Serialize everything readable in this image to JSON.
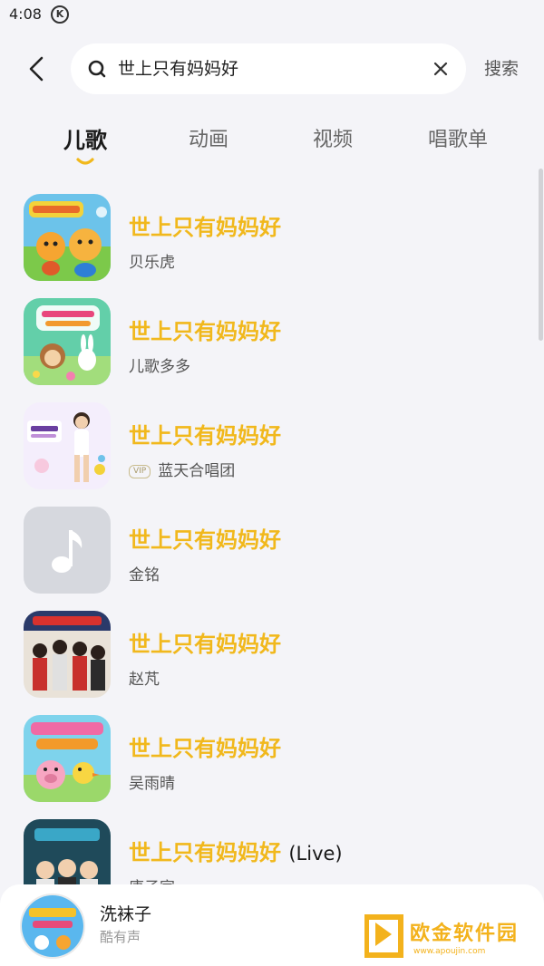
{
  "status_bar": {
    "time": "4:08",
    "indicator": "K"
  },
  "search": {
    "query": "世上只有妈妈好",
    "action_label": "搜索"
  },
  "tabs": [
    {
      "label": "儿歌",
      "active": true
    },
    {
      "label": "动画",
      "active": false
    },
    {
      "label": "视频",
      "active": false
    },
    {
      "label": "唱歌单",
      "active": false
    }
  ],
  "songs": [
    {
      "title": "世上只有妈妈好",
      "artist": "贝乐虎",
      "cover": "cartoon-tigers-cover",
      "vip": false
    },
    {
      "title": "世上只有妈妈好",
      "artist": "儿歌多多",
      "cover": "monkey-rabbit-cover",
      "vip": false
    },
    {
      "title": "世上只有妈妈好",
      "artist": "蓝天合唱团",
      "cover": "little-singer-cover",
      "vip": true,
      "vip_label": "VIP"
    },
    {
      "title": "世上只有妈妈好",
      "artist": "金铭",
      "cover": "music-note-placeholder",
      "vip": false
    },
    {
      "title": "世上只有妈妈好",
      "artist": "赵芃",
      "cover": "children-group-photo",
      "vip": false
    },
    {
      "title": "世上只有妈妈好",
      "artist": "吴雨晴",
      "cover": "piggy-chick-cover",
      "vip": false
    },
    {
      "title": "世上只有妈妈好",
      "title_suffix": "(Live)",
      "artist": "唐子宣",
      "cover": "live-show-cover",
      "vip": false
    }
  ],
  "player": {
    "title": "洗袜子",
    "subtitle": "酷有声"
  },
  "watermark": {
    "text": "欧金软件园",
    "url": "www.apoujin.com"
  },
  "colors": {
    "accent": "#f1b81c",
    "background": "#f4f4f8"
  }
}
